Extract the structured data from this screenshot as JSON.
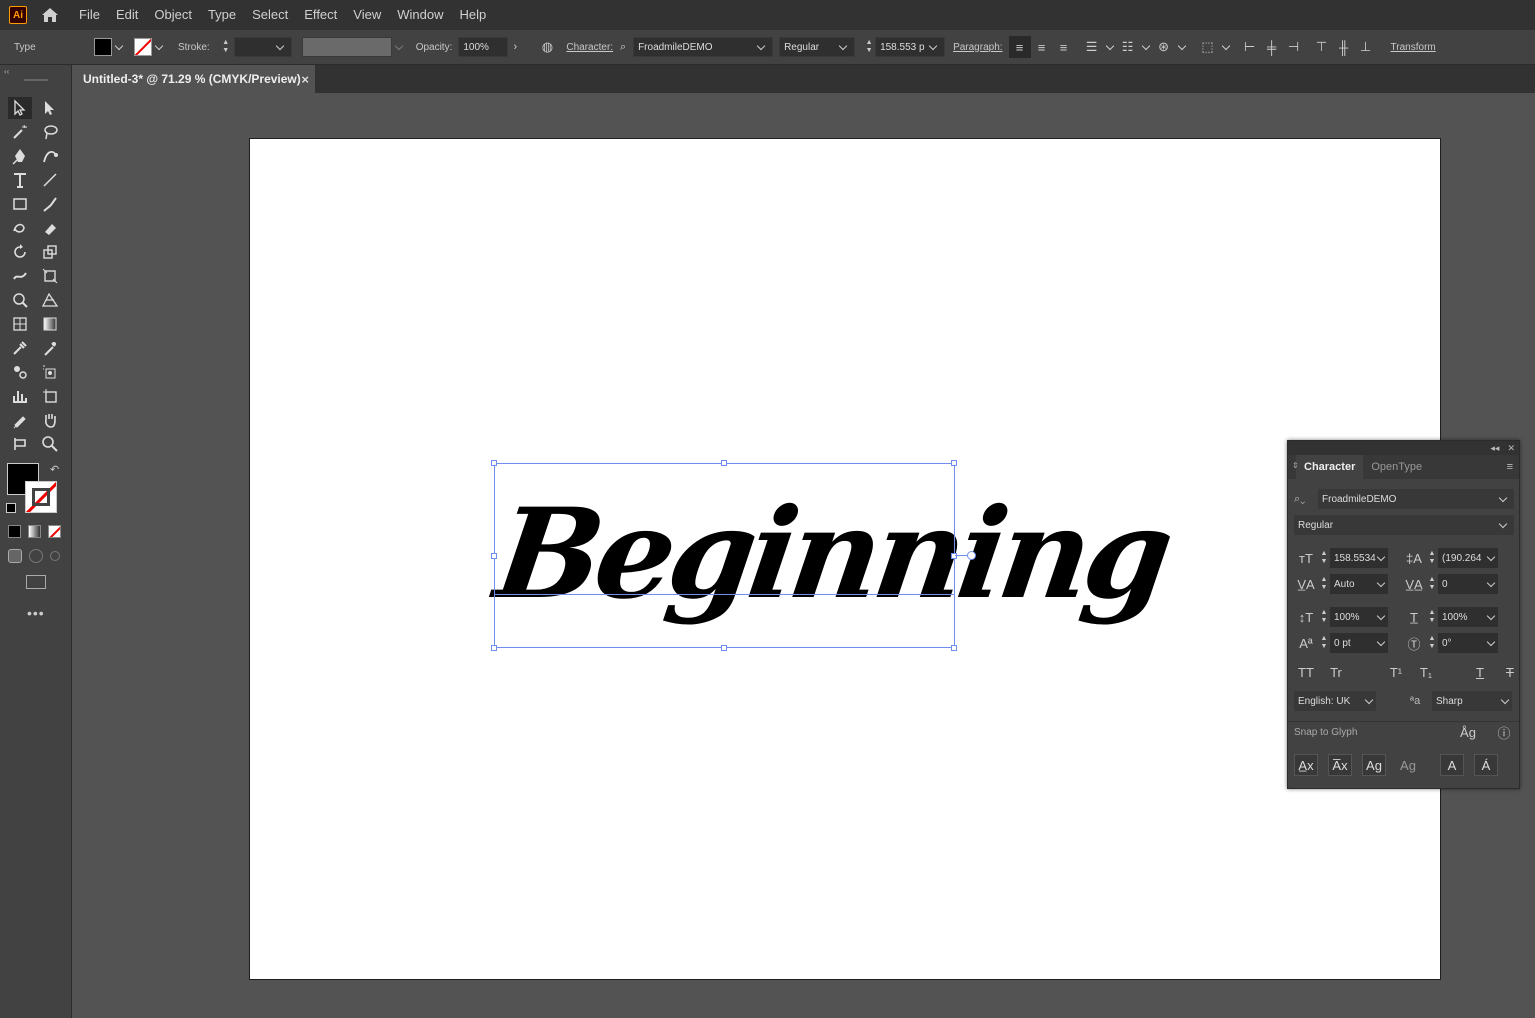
{
  "app": {
    "logo": "Ai"
  },
  "menu": [
    "File",
    "Edit",
    "Object",
    "Type",
    "Select",
    "Effect",
    "View",
    "Window",
    "Help"
  ],
  "control": {
    "mode": "Type",
    "stroke_label": "Stroke:",
    "opacity_label": "Opacity:",
    "opacity_value": "100%",
    "character_label": "Character:",
    "font_family": "FroadmileDEMO",
    "font_style": "Regular",
    "font_size": "158.553 p",
    "paragraph_label": "Paragraph:",
    "transform_label": "Transform",
    "fill_color": "#000000"
  },
  "document": {
    "tab_title": "Untitled-3* @ 71.29 % (CMYK/Preview)",
    "artboard_text": "Beginning"
  },
  "character_panel": {
    "tabs": [
      "Character",
      "OpenType"
    ],
    "font_family": "FroadmileDEMO",
    "font_style": "Regular",
    "font_size": "158.5534",
    "leading": "(190.264",
    "kerning": "Auto",
    "tracking": "0",
    "vertical_scale": "100%",
    "horizontal_scale": "100%",
    "baseline_shift": "0 pt",
    "rotation": "0°",
    "language": "English: UK",
    "antialias": "Sharp",
    "snap_to_glyph": "Snap to Glyph",
    "glyph_buttons": [
      "TT",
      "Tr",
      "T¹",
      "T₁",
      "T",
      "T"
    ],
    "aa_label": "ªa"
  },
  "colors": {
    "accent": "#6f8ff0",
    "ui_dark": "#323232",
    "ui_mid": "#424242",
    "canvas": "#535353"
  }
}
